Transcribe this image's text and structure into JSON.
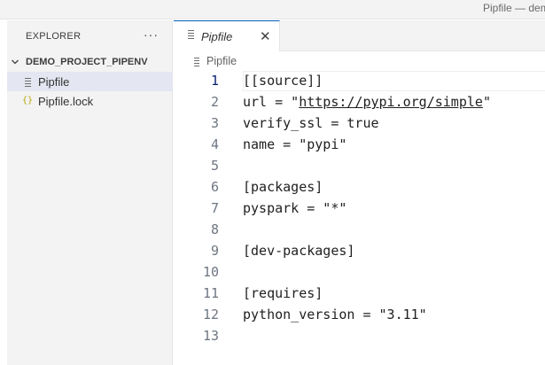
{
  "window": {
    "title": "Pipfile — dem"
  },
  "sidebar": {
    "header": "EXPLORER",
    "more_icon": "ellipsis-icon",
    "section": "DEMO_PROJECT_PIPENV",
    "files": [
      {
        "name": "Pipfile",
        "icon": "file-lines-icon",
        "selected": true
      },
      {
        "name": "Pipfile.lock",
        "icon": "json-braces-icon",
        "selected": false
      }
    ]
  },
  "tabs": [
    {
      "label": "Pipfile",
      "close_glyph": "✕"
    }
  ],
  "breadcrumb": {
    "file": "Pipfile"
  },
  "editor": {
    "active_line": 1,
    "lines": [
      {
        "n": "1",
        "pre": "[[source]]"
      },
      {
        "n": "2",
        "pre": "url = \"",
        "url": "https://pypi.org/simple",
        "post": "\""
      },
      {
        "n": "3",
        "pre": "verify_ssl = true"
      },
      {
        "n": "4",
        "pre": "name = \"pypi\""
      },
      {
        "n": "5",
        "pre": ""
      },
      {
        "n": "6",
        "pre": "[packages]"
      },
      {
        "n": "7",
        "pre": "pyspark = \"*\""
      },
      {
        "n": "8",
        "pre": ""
      },
      {
        "n": "9",
        "pre": "[dev-packages]"
      },
      {
        "n": "10",
        "pre": ""
      },
      {
        "n": "11",
        "pre": "[requires]"
      },
      {
        "n": "12",
        "pre": "python_version = \"3.11\""
      },
      {
        "n": "13",
        "pre": ""
      }
    ]
  },
  "colors": {
    "accent": "#005fb8",
    "selection": "#e4e6f1",
    "json_icon": "#cbcb41"
  }
}
